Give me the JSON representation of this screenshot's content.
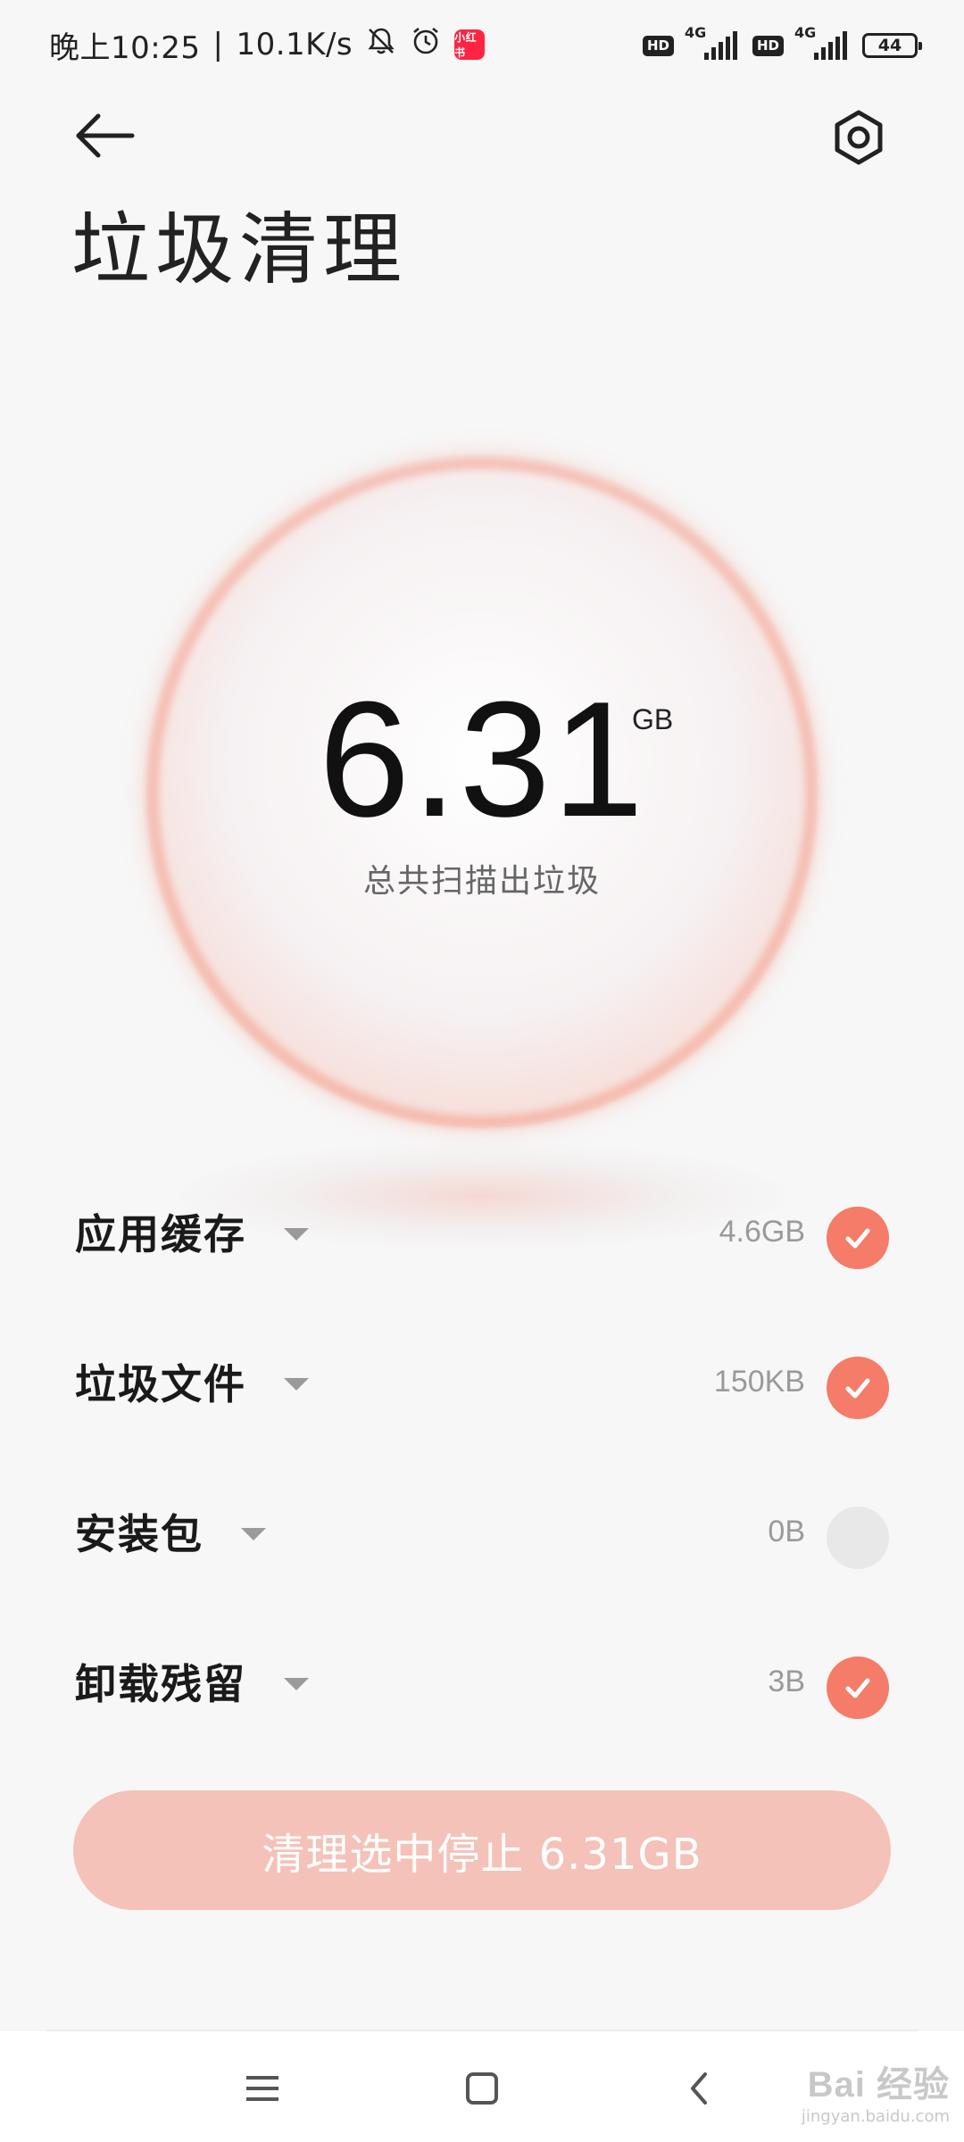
{
  "status_bar": {
    "time": "晚上10:25",
    "separator": "|",
    "network_speed": "10.1K/s",
    "app_badge": "小红书",
    "hd_label": "HD",
    "network_type": "4G",
    "battery": "44"
  },
  "header": {
    "title": "垃圾清理"
  },
  "summary": {
    "total_value": "6.31",
    "total_unit": "GB",
    "caption": "总共扫描出垃圾"
  },
  "items": [
    {
      "label": "应用缓存",
      "size": "4.6GB",
      "checked": true
    },
    {
      "label": "垃圾文件",
      "size": "150KB",
      "checked": true
    },
    {
      "label": "安装包",
      "size": "0B",
      "checked": false
    },
    {
      "label": "卸载残留",
      "size": "3B",
      "checked": true
    }
  ],
  "clean_button": {
    "label": "清理选中停止 6.31GB"
  },
  "colors": {
    "accent": "#f47c68",
    "button_bg": "#f4c2b9",
    "background": "#f7f7f7"
  },
  "icons": [
    "back-arrow-icon",
    "settings-hexagon-icon",
    "mute-bell-icon",
    "alarm-icon",
    "signal-icon",
    "battery-icon",
    "chevron-down-icon",
    "checkmark-icon",
    "menu-icon",
    "home-icon",
    "back-icon"
  ],
  "watermark": {
    "main": "Bai 经验",
    "sub": "jingyan.baidu.com"
  }
}
